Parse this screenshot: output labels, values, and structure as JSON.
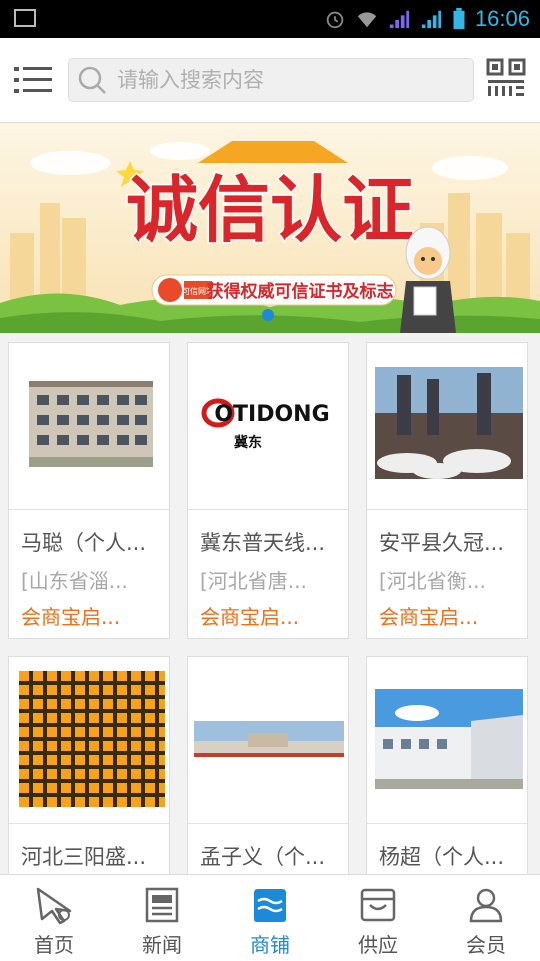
{
  "status_bar": {
    "time": "16:06"
  },
  "search": {
    "placeholder": "请输入搜索内容"
  },
  "banner": {
    "title": "诚信认证",
    "subtitle": "获得权威可信证书及标志",
    "logo_text": "可信网站"
  },
  "cards": [
    {
      "name": "马聪（个人...",
      "location": "[山东省淄...",
      "tag": "会商宝启..."
    },
    {
      "name": "冀东普天线...",
      "location": "[河北省唐...",
      "tag": "会商宝启...",
      "logo_text": "OTIDONG",
      "logo_sub": "冀东"
    },
    {
      "name": "安平县久冠...",
      "location": "[河北省衡...",
      "tag": "会商宝启..."
    },
    {
      "name": "河北三阳盛...",
      "location": "",
      "tag": ""
    },
    {
      "name": "孟子义（个...",
      "location": "",
      "tag": ""
    },
    {
      "name": "杨超（个人...",
      "location": "",
      "tag": ""
    }
  ],
  "tabs": [
    {
      "label": "首页",
      "icon": "home-icon"
    },
    {
      "label": "新闻",
      "icon": "news-icon"
    },
    {
      "label": "商铺",
      "icon": "shop-icon",
      "active": true
    },
    {
      "label": "供应",
      "icon": "supply-icon"
    },
    {
      "label": "会员",
      "icon": "member-icon"
    }
  ],
  "colors": {
    "accent": "#1c8ad8",
    "tag": "#f26d16",
    "status_icons": "#33b5e5"
  }
}
